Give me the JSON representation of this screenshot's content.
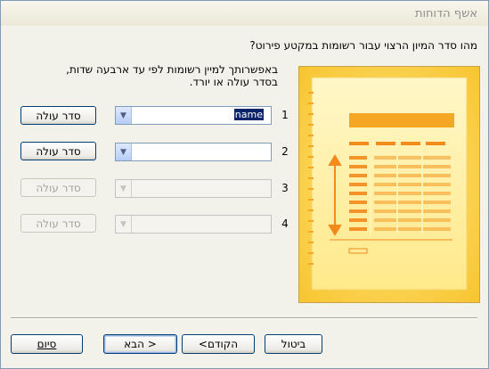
{
  "window": {
    "title": "אשף הדוחות"
  },
  "question": "מהו סדר המיון הרצוי עבור רשומות במקטע פירוט?",
  "description": {
    "line1": "באפשרותך למיין רשומות לפי עד ארבעה שדות,",
    "line2": "בסדר עולה או יורד."
  },
  "sort_rows": [
    {
      "number": "1",
      "field_value": "name",
      "order_label": "סדר עולה",
      "enabled": true
    },
    {
      "number": "2",
      "field_value": "",
      "order_label": "סדר עולה",
      "enabled": true
    },
    {
      "number": "3",
      "field_value": "",
      "order_label": "סדר עולה",
      "enabled": false
    },
    {
      "number": "4",
      "field_value": "",
      "order_label": "סדר עולה",
      "enabled": false
    }
  ],
  "buttons": {
    "cancel": "ביטול",
    "back": "<הקודם",
    "next": "הבא >",
    "finish": "סיום"
  },
  "colors": {
    "illustration_bg": "#f7c531",
    "illustration_page": "#fff3b5",
    "illustration_accent": "#f28a1c"
  }
}
